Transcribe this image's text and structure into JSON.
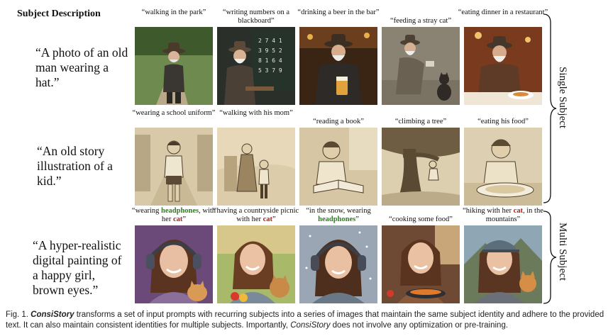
{
  "header": "Subject Description",
  "rows": [
    {
      "description": "“A photo of an old man wearing a hat.”",
      "captions": [
        {
          "text": "“walking in the park”"
        },
        {
          "text": "“writing numbers on a blackboard”"
        },
        {
          "text": "“drinking a beer in the bar”"
        },
        {
          "text": "“feeding a stray cat”"
        },
        {
          "text": "“eating dinner in a restaurant”"
        }
      ]
    },
    {
      "description": "“An old story illustration of a kid.”",
      "captions": [
        {
          "text": "“wearing a school uniform”"
        },
        {
          "text": "“walking with his mom”"
        },
        {
          "text": "“reading a book”"
        },
        {
          "text": "“climbing a tree”"
        },
        {
          "text": "“eating his food”"
        }
      ]
    },
    {
      "description": "“A hyper-realistic digital painting of a happy girl, brown eyes.”",
      "captions": [
        {
          "pre": "“wearing ",
          "green": "headphones",
          "mid": ", with her ",
          "red": "cat",
          "post": "”"
        },
        {
          "pre": "“having a countryside picnic with her ",
          "red": "cat",
          "post": "”"
        },
        {
          "pre": "“in the snow, wearing ",
          "green": "headphones",
          "post": "”"
        },
        {
          "text": "“cooking some food”"
        },
        {
          "pre": "“hiking with her ",
          "red": "cat",
          "mid": ", in the mountains",
          "post": "”"
        }
      ]
    }
  ],
  "side_labels": {
    "single": "Single Subject",
    "multi": "Multi Subject"
  },
  "figure_caption": {
    "label": "Fig. 1.",
    "name": "ConsiStory",
    "text1": " transforms a set of input prompts with recurring subjects into a series of images that maintain the same subject identity and adhere to the provided text. It can also maintain consistent identities for multiple subjects. Importantly, ",
    "name2": "ConsiStory",
    "text2": " does not involve any optimization or pre-training."
  },
  "colors": {
    "green_highlight": "#2e7d1e",
    "red_highlight": "#b3201a"
  }
}
